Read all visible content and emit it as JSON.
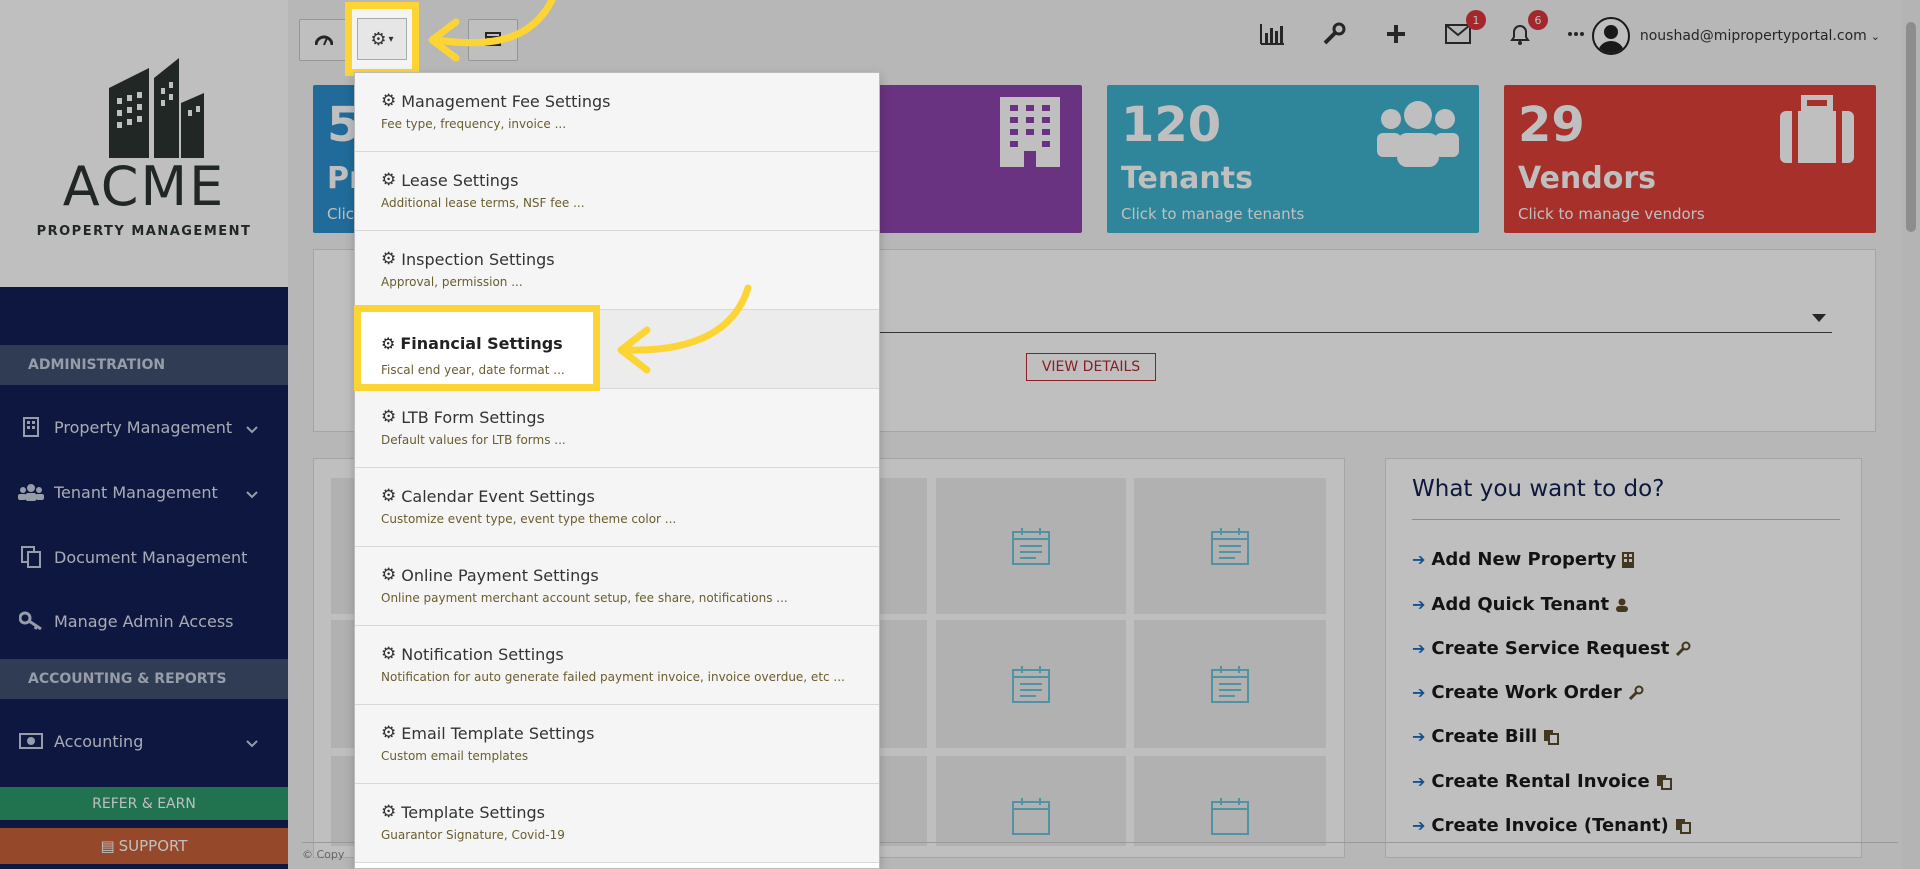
{
  "brand": {
    "name": "ACME",
    "tagline": "PROPERTY MANAGEMENT"
  },
  "sidebar": {
    "section_admin": "ADMINISTRATION",
    "section_accounting": "ACCOUNTING & REPORTS",
    "items": [
      {
        "label": "Property Management",
        "icon": "building-icon"
      },
      {
        "label": "Tenant Management",
        "icon": "users-icon"
      },
      {
        "label": "Document Management",
        "icon": "documents-icon"
      },
      {
        "label": "Manage Admin Access",
        "icon": "key-icon"
      },
      {
        "label": "Accounting",
        "icon": "money-icon"
      }
    ],
    "refer_label": "REFER & EARN",
    "support_label": "SUPPORT"
  },
  "topbar": {
    "messages_count": "1",
    "notifications_count": "6",
    "user_email": "noushad@mipropertyportal.com"
  },
  "cards": [
    {
      "number": "5",
      "label": "Pr",
      "sub": "Clic",
      "color": "#2c8fce"
    },
    {
      "number": "",
      "label": "",
      "sub": "",
      "color": "#8e44ad"
    },
    {
      "number": "120",
      "label": "Tenants",
      "sub": "Click to manage tenants",
      "color": "#3fb3cf"
    },
    {
      "number": "29",
      "label": "Vendors",
      "sub": "Click to manage vendors",
      "color": "#e0413a"
    }
  ],
  "main": {
    "view_details_label": "VIEW DETAILS"
  },
  "what_to_do": {
    "title": "What you want to do?",
    "actions": [
      "Add New Property",
      "Add Quick Tenant",
      "Create Service Request",
      "Create Work Order",
      "Create Bill",
      "Create Rental Invoice",
      "Create Invoice (Tenant)"
    ]
  },
  "footer": {
    "text": "© Copy"
  },
  "settings_menu": {
    "items": [
      {
        "title": "Management Fee Settings",
        "desc": "Fee type, frequency, invoice ..."
      },
      {
        "title": "Lease Settings",
        "desc": "Additional lease terms, NSF fee ..."
      },
      {
        "title": "Inspection Settings",
        "desc": "Approval, permission ..."
      },
      {
        "title": "Financial Settings",
        "desc": "Fiscal end year, date format ..."
      },
      {
        "title": "LTB Form Settings",
        "desc": "Default values for LTB forms ..."
      },
      {
        "title": "Calendar Event Settings",
        "desc": "Customize event type, event type theme color ..."
      },
      {
        "title": "Online Payment Settings",
        "desc": "Online payment merchant account setup, fee share, notifications ..."
      },
      {
        "title": "Notification Settings",
        "desc": "Notification for auto generate failed payment invoice, invoice overdue, etc ..."
      },
      {
        "title": "Email Template Settings",
        "desc": "Custom email templates"
      },
      {
        "title": "Template Settings",
        "desc": "Guarantor Signature, Covid-19"
      }
    ]
  },
  "colors": {
    "highlight": "#fcd535",
    "sidebar_bg": "#121f54"
  }
}
